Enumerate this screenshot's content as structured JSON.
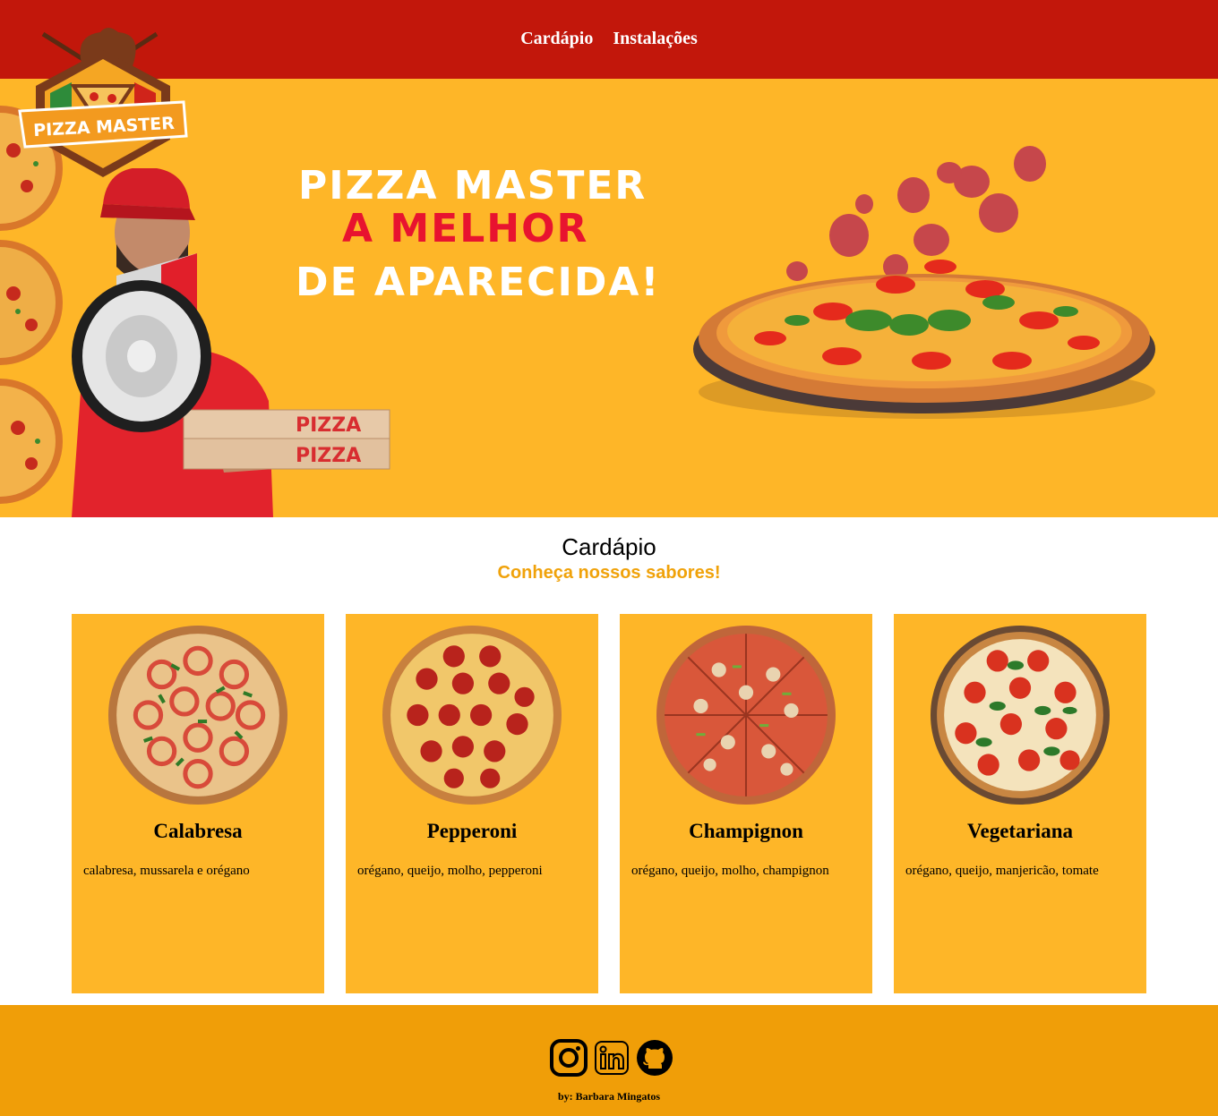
{
  "nav": {
    "items": [
      {
        "label": "Cardápio"
      },
      {
        "label": "Instalações"
      }
    ]
  },
  "logo": {
    "text": "PIZZA MASTER"
  },
  "hero": {
    "line1": "PIZZA MASTER",
    "line2": "A MELHOR",
    "line3": "DE APARECIDA!",
    "box_text": "PIZZA"
  },
  "menu": {
    "title": "Cardápio",
    "subtitle": "Conheça nossos sabores!",
    "items": [
      {
        "name": "Calabresa",
        "desc": "calabresa, mussarela e orégano"
      },
      {
        "name": "Pepperoni",
        "desc": "orégano, queijo, molho, pepperoni"
      },
      {
        "name": "Champignon",
        "desc": "orégano, queijo, molho, champignon"
      },
      {
        "name": "Vegetariana",
        "desc": "orégano, queijo, manjericão, tomate"
      }
    ]
  },
  "footer": {
    "icons": [
      "instagram-icon",
      "linkedin-icon",
      "github-icon"
    ],
    "credit": "by: Barbara Mingatos"
  },
  "colors": {
    "header": "#c2170b",
    "hero": "#feb628",
    "accent": "#f0a20a",
    "footer": "#f09e08",
    "headline_red": "#e8132f"
  }
}
